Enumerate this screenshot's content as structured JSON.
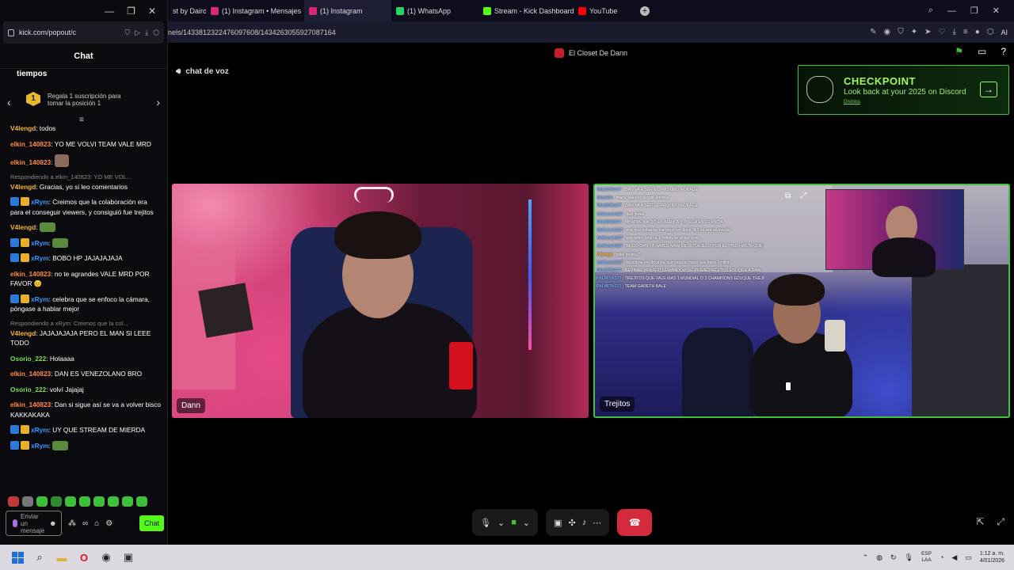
{
  "browser": {
    "tabs": [
      {
        "label": "st by Dairo",
        "icon_color": "#4a4a6a"
      },
      {
        "label": "(1) Instagram • Mensajes",
        "icon_color": "#d62976"
      },
      {
        "label": "(1) Instagram",
        "icon_color": "#d62976",
        "active": true
      },
      {
        "label": "(1) WhatsApp",
        "icon_color": "#25d366"
      },
      {
        "label": "Stream - Kick Dashboard",
        "icon_color": "#53fc18"
      },
      {
        "label": "YouTube",
        "icon_color": "#ff0000"
      }
    ],
    "new_tab_label": "+",
    "url": "nels/1433812322476097608/1434263055927087164",
    "ai_label": "AI"
  },
  "popout": {
    "url": "kick.com/popout/c",
    "chat_title": "Chat",
    "promo_title": "tiempos",
    "promo_rank": "1",
    "promo_desc": "Regala 1 suscripción para tomar la posición 1",
    "messages": [
      {
        "user": "V4lengd",
        "color": "#f5b52e",
        "text": "todos"
      },
      {
        "user": "elkin_140823",
        "color": "#ff8a3d",
        "text": "YO ME VOLVI TEAM VALE MRD"
      },
      {
        "user": "elkin_140823",
        "color": "#ff8a3d",
        "text": "",
        "emote": true
      },
      {
        "reply": "Respondiendo a elkin_140823: YO ME VOL...",
        "user": "V4lengd",
        "color": "#f5b52e",
        "text": "Gracias, yo si leo comentarios"
      },
      {
        "user": "xRym",
        "color": "#2f9bff",
        "badges": true,
        "text": "Creimos que la colaboración era para el conseguir viewers, y consiguió fue trejitos"
      },
      {
        "user": "V4lengd",
        "color": "#f5b52e",
        "text": "",
        "emote": true
      },
      {
        "user": "xRym",
        "color": "#2f9bff",
        "badges": true,
        "text": "",
        "emote": true
      },
      {
        "user": "xRym",
        "color": "#2f9bff",
        "badges": true,
        "text": "BOBO HP JAJAJAJAJA"
      },
      {
        "user": "elkin_140823",
        "color": "#ff8a3d",
        "text": "no te agrandes VALE MRD POR FAVOR 😊"
      },
      {
        "user": "xRym",
        "color": "#2f9bff",
        "badges": true,
        "text": "celebra que se enfoco la cámara, póngase a hablar mejor"
      },
      {
        "reply": "Respondiendo a xRym: Creimos que la col...",
        "user": "V4lengd",
        "color": "#f5b52e",
        "text": "JAJAJAJAJA PERO EL MAN SI LEEE TODO"
      },
      {
        "user": "Osorio_222",
        "color": "#7be04a",
        "text": "Holaaaa"
      },
      {
        "user": "elkin_140823",
        "color": "#ff8a3d",
        "text": "DAN ES VENEZOLANO BRO"
      },
      {
        "user": "Osorio_222",
        "color": "#7be04a",
        "text": "volví Jajajaj"
      },
      {
        "user": "elkin_140823",
        "color": "#ff8a3d",
        "text": "Dan si sigue así se va a volver bisco KAKKAKAKA"
      },
      {
        "user": "xRym",
        "color": "#2f9bff",
        "badges": true,
        "text": "UY QUE STREAM DE MIERDA"
      },
      {
        "user": "xRym",
        "color": "#2f9bff",
        "badges": true,
        "text": "",
        "emote": true
      }
    ],
    "input_placeholder": "Enviar un mensaje",
    "send_label": "Chat"
  },
  "stage": {
    "server_name": "El Closet De Dann",
    "voice_label": "chat de voz",
    "checkpoint": {
      "title": "CHECKPOINT",
      "subtitle": "Look back at your 2025 on Discord",
      "dismiss": "Dismiss"
    },
    "participants": [
      {
        "name": "Dann"
      },
      {
        "name": "Trejitos"
      }
    ],
    "overlay_chat": [
      {
        "user": "PALMITAS77",
        "text": "DAN VA A SER EL PROXIMO HOKAGE"
      },
      {
        "user": "Renaldo",
        "text": "mano saludos desde Antonia"
      },
      {
        "user": "PALMITAS77",
        "text": "DAN VA A SER EL PROXIMO HOKAGE"
      },
      {
        "user": "Amilcrack117",
        "text": "que putas"
      },
      {
        "user": "PALMITAS77",
        "text": "MBAPPE NACIO EN AFRICA Y JUEGA EN FRANCIA"
      },
      {
        "user": "Amilcrack117",
        "text": "ese que putas se me pego en tiktok 3k2 no era un insulto"
      },
      {
        "user": "Amilcrack117",
        "text": "ese video llegó a 1 millón de vistas ayer"
      },
      {
        "user": "Amilcrack117",
        "text": "BROO DAN YA HABLO MAM DE UD DEJELO POR EL PISO HASTA QUE EL PEO ESTALLE"
      },
      {
        "user": "V4lengd",
        "text": "infiel trejitos?"
      },
      {
        "user": "Amilcrack117",
        "text": "búscame en tiktok pa que veas el video que tiene 1millón"
      },
      {
        "user": "PALMITAS77",
        "text": "NEYMAR PRIME O LEWANDOWSKI PRIME TREJITOS EDUQUE A DAN"
      },
      {
        "user": "PALMITAS77",
        "text": "TREJITOS QUE VALE MAS 1 MUNDIAL O 3 CHAMPIONS EDUQUE TREJITOS EDUQUE"
      },
      {
        "user": "PALMITAS77",
        "text": "TEAM GARETH BALE"
      }
    ]
  },
  "taskbar": {
    "lang_line1": "ESP",
    "lang_line2": "LAA",
    "time": "1:12 a. m.",
    "date": "4/01/2026"
  }
}
